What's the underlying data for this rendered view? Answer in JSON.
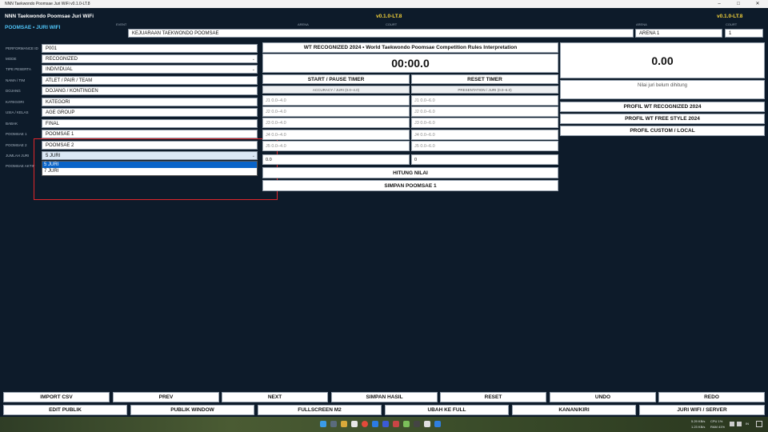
{
  "window": {
    "title": "NNN Taekwondo Poomsae Juri WiFi v0.1.0-LT.8"
  },
  "header": {
    "app_title": "NNN Taekwondo Poomsae Juri WiFi",
    "subtitle": "POOMSAE • JURI WIFI",
    "version_center": "v0.1.0-LT.8",
    "version_right": "v0.1.0-LT.8",
    "event_label": "EVENT",
    "event_value": "KEJUARAAN TAEKWONDO POOMSAE",
    "arena_label_small": "ARENA",
    "court_label_small": "COURT",
    "arena_label": "ARENA",
    "arena_value": "ARENA 1",
    "court_label": "COURT",
    "court_value": "1"
  },
  "form": {
    "fields": [
      {
        "label": "PERFORMANCE ID",
        "value": "P001",
        "select": false
      },
      {
        "label": "MODE",
        "value": "RECOGNIZED",
        "select": true
      },
      {
        "label": "TIPE PESERTA",
        "value": "INDIVIDUAL",
        "select": true
      },
      {
        "label": "NAMA / TIM",
        "value": "ATLET / PAIR / TEAM",
        "select": false
      },
      {
        "label": "DOJANG",
        "value": "DOJANG / KONTINGEN",
        "select": false
      },
      {
        "label": "KATEGORI",
        "value": "KATEGORI",
        "select": false
      },
      {
        "label": "USIA / KELAS",
        "value": "AGE GROUP",
        "select": false
      },
      {
        "label": "BABAK",
        "value": "FINAL",
        "select": false
      },
      {
        "label": "POOMSAE 1",
        "value": "POOMSAE 1",
        "select": false
      },
      {
        "label": "POOMSAE 2",
        "value": "POOMSAE 2",
        "select": false
      }
    ],
    "jumlah_juri_label": "JUMLAH JURI",
    "jumlah_juri_value": "5 JURI",
    "poomsae_aktif_label": "POOMSAE AKTIF",
    "dropdown_options": [
      "5 JURI",
      "7 JURI"
    ]
  },
  "center": {
    "rules_title": "WT RECOGNIZED 2024 • World Taekwondo Poomsae Competition Rules  Interpretation",
    "timer": "00:00.0",
    "start_pause": "START / PAUSE TIMER",
    "reset_timer": "RESET TIMER",
    "accuracy_header": "ACCURACY / JURI  (0.0–4.0)",
    "presentation_header": "PRESENTATION / JURI  (0.0–6.0)",
    "accuracy_placeholders": [
      "J1  0.0–4.0",
      "J2  0.0–4.0",
      "J3  0.0–4.0",
      "J4  0.0–4.0",
      "J5  0.0–4.0"
    ],
    "presentation_placeholders": [
      "J1  0.0–6.0",
      "J2  0.0–6.0",
      "J3  0.0–6.0",
      "J4  0.0–6.0",
      "J5  0.0–6.0"
    ],
    "deduction_left": "0.0",
    "deduction_right": "0",
    "hitung_nilai": "HITUNG NILAI",
    "simpan_poomsae": "SIMPAN POOMSAE 1"
  },
  "right": {
    "score": "0.00",
    "status": "Nilai juri belum dihitung",
    "profiles": [
      "PROFIL WT RECOGNIZED 2024",
      "PROFIL WT FREE STYLE 2024",
      "PROFIL CUSTOM / LOCAL"
    ]
  },
  "bottom": {
    "row1": [
      "IMPORT CSV",
      "PREV",
      "NEXT",
      "SIMPAN HASIL",
      "RESET",
      "UNDO",
      "REDO"
    ],
    "row2": [
      "EDIT PUBLIK",
      "PUBLIK WINDOW",
      "FULLSCREEN M2",
      "UBAH KE FULL",
      "KANAN/KIRI",
      "JURI WIFI / SERVER"
    ]
  },
  "taskbar": {
    "net_up": "5.29 KB/s",
    "net_down": "1.23 KB/s",
    "cpu": "CPU 1%",
    "ram": "RAM 41%",
    "lang": "IN"
  },
  "colors": {
    "background": "#0d1b2a",
    "accent_cyan": "#4fc3f7",
    "version_yellow": "#f5d33a",
    "selection_blue": "#0a64c8",
    "highlight_red": "#e0262b"
  }
}
